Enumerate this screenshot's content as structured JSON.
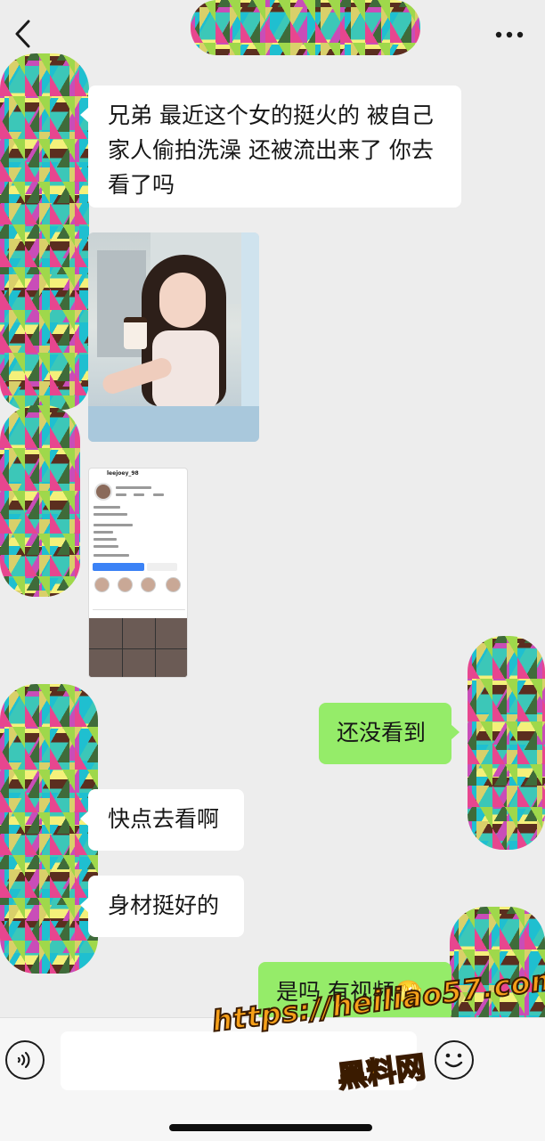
{
  "messages": {
    "incoming_1": "兄弟 最近这个女的挺火的 被自己家人偷拍洗澡 还被流出来了 你去看了吗",
    "outgoing_1": "还没看到",
    "incoming_2": "快点去看啊",
    "incoming_3": "身材挺好的",
    "outgoing_2": "是吗 有视频🫣"
  },
  "profile_screenshot": {
    "username": "leejoey_98"
  },
  "watermark": {
    "url": "https://heiliao57.com",
    "cn": "黑料网"
  },
  "icons": {
    "back": "chevron-left-icon",
    "more": "more-dots-icon",
    "voice": "voice-icon",
    "emoji": "emoji-icon"
  },
  "colors": {
    "background": "#ededed",
    "incoming_bubble": "#ffffff",
    "outgoing_bubble": "#95ec69",
    "watermark": "#f6a019"
  }
}
